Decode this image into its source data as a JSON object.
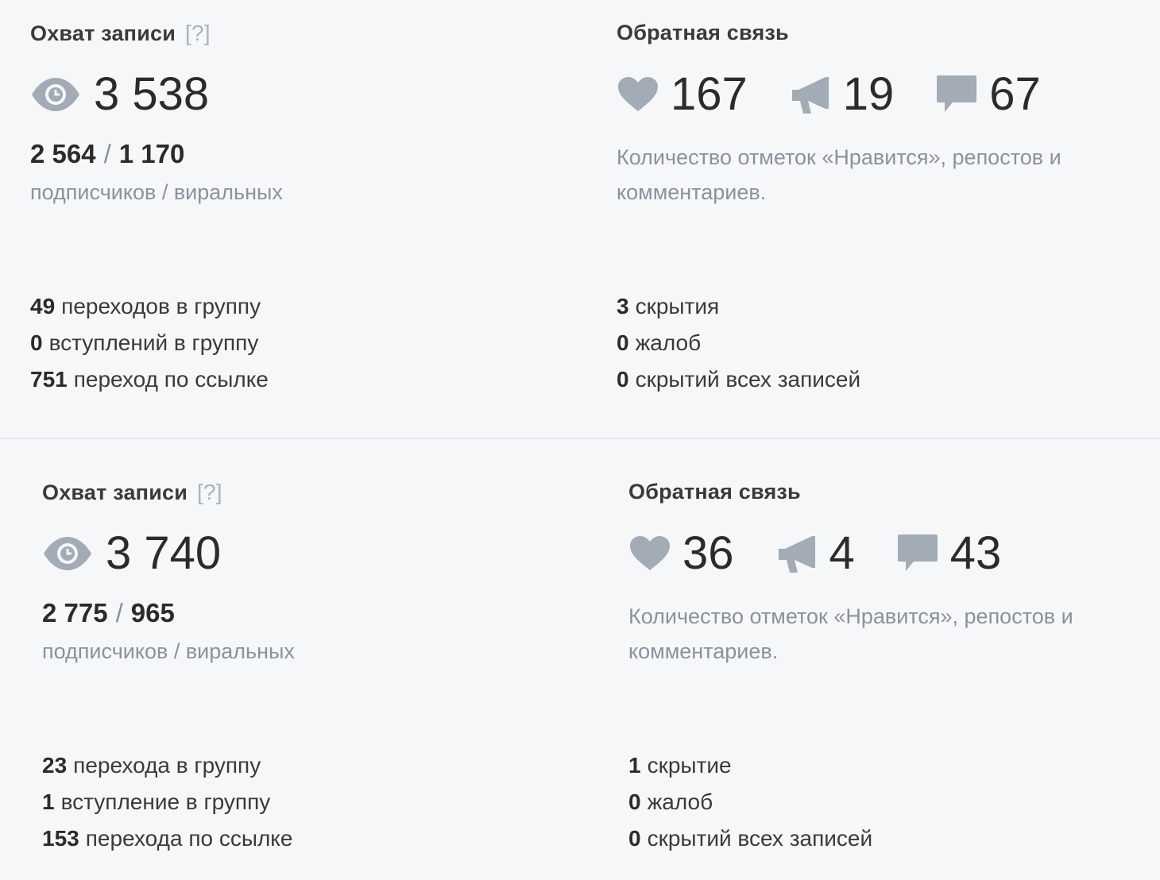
{
  "posts": [
    {
      "reach": {
        "heading": "Охват записи",
        "help": "[?]",
        "total": "3 538",
        "subscribers": "2 564",
        "separator": "/",
        "viral": "1 170",
        "caption": "подписчиков / виральных",
        "stats": [
          {
            "value": "49",
            "label": "переходов в группу"
          },
          {
            "value": "0",
            "label": "вступлений в группу"
          },
          {
            "value": "751",
            "label": "переход по ссылке"
          }
        ]
      },
      "feedback": {
        "heading": "Обратная связь",
        "likes": "167",
        "reposts": "19",
        "comments": "67",
        "caption": "Количество отметок «Нравится», репостов и комментариев.",
        "stats": [
          {
            "value": "3",
            "label": "скрытия"
          },
          {
            "value": "0",
            "label": "жалоб"
          },
          {
            "value": "0",
            "label": "скрытий всех записей"
          }
        ]
      }
    },
    {
      "reach": {
        "heading": "Охват записи",
        "help": "[?]",
        "total": "3 740",
        "subscribers": "2 775",
        "separator": "/",
        "viral": "965",
        "caption": "подписчиков / виральных",
        "stats": [
          {
            "value": "23",
            "label": "перехода в группу"
          },
          {
            "value": "1",
            "label": "вступление в группу"
          },
          {
            "value": "153",
            "label": "перехода по ссылке"
          }
        ]
      },
      "feedback": {
        "heading": "Обратная связь",
        "likes": "36",
        "reposts": "4",
        "comments": "43",
        "caption": "Количество отметок «Нравится», репостов и комментариев.",
        "stats": [
          {
            "value": "1",
            "label": "скрытие"
          },
          {
            "value": "0",
            "label": "жалоб"
          },
          {
            "value": "0",
            "label": "скрытий всех записей"
          }
        ]
      }
    }
  ],
  "colors": {
    "background": "#f6f7f9",
    "icon": "#a3abb6",
    "muted_text": "#8a929c",
    "help": "#a8b3c2",
    "divider": "#e3e5e8"
  }
}
